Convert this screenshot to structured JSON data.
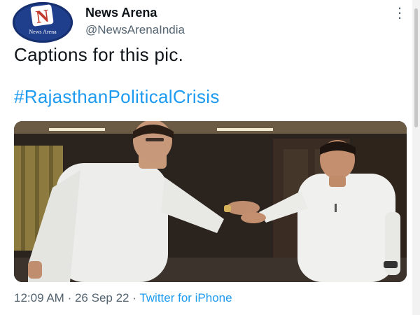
{
  "author": {
    "display_name": "News Arena",
    "handle": "@NewsArenaIndia",
    "avatar_text": "News Arena",
    "avatar_icon": "news-arena-logo"
  },
  "tweet": {
    "text": "Captions for this pic.",
    "hashtag": "#RajasthanPoliticalCrisis",
    "photo_description": "Two men in white kurtas talking indoors",
    "time": "12:09 AM",
    "separator": "·",
    "date": "26 Sep 22",
    "source": "Twitter for iPhone"
  },
  "icons": {
    "more": "more-vertical-icon"
  },
  "colors": {
    "link": "#1d9bf0",
    "secondary_text": "#536471",
    "primary_text": "#0f1419"
  }
}
